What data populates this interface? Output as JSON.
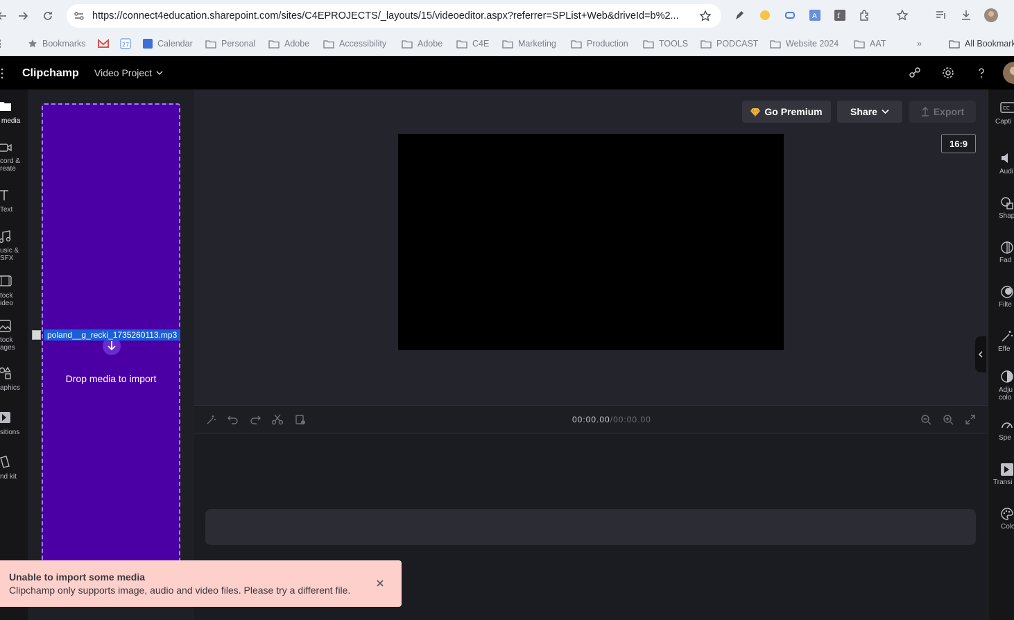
{
  "browser": {
    "url": "https://connect4education.sharepoint.com/sites/C4EPROJECTS/_layouts/15/videoeditor.aspx?referrer=SPList+Web&driveId=b%2...",
    "bookmarks": [
      {
        "label": "Bookmarks",
        "icon": "star-icon"
      },
      {
        "label": "",
        "icon": "gmail-icon"
      },
      {
        "label": "",
        "icon": "calendar-app-icon"
      },
      {
        "label": "Calendar",
        "icon": "calendar-icon"
      },
      {
        "label": "Personal",
        "icon": "folder-icon"
      },
      {
        "label": "Adobe",
        "icon": "folder-icon"
      },
      {
        "label": "Accessibility",
        "icon": "folder-icon"
      },
      {
        "label": "Adobe",
        "icon": "folder-icon"
      },
      {
        "label": "C4E",
        "icon": "folder-icon"
      },
      {
        "label": "Marketing",
        "icon": "folder-icon"
      },
      {
        "label": "Production",
        "icon": "folder-icon"
      },
      {
        "label": "TOOLS",
        "icon": "folder-icon"
      },
      {
        "label": "PODCAST",
        "icon": "folder-icon"
      },
      {
        "label": "Website 2024",
        "icon": "folder-icon"
      },
      {
        "label": "AAT",
        "icon": "folder-icon"
      }
    ],
    "more_bookmarks": "»",
    "all_bookmarks": "All Bookmarks"
  },
  "app": {
    "brand": "Clipchamp",
    "project_name": "Video Project"
  },
  "left_rail": [
    {
      "label": "media",
      "icon": "folder-icon"
    },
    {
      "label": "cord & reate",
      "icon": "camera-icon"
    },
    {
      "label": "Text",
      "icon": "text-icon"
    },
    {
      "label": "usic & SFX",
      "icon": "music-icon"
    },
    {
      "label": "tock ideo",
      "icon": "film-icon"
    },
    {
      "label": "tock ages",
      "icon": "image-icon"
    },
    {
      "label": "aphics",
      "icon": "shapes-icon"
    },
    {
      "label": "sitions",
      "icon": "transition-icon"
    },
    {
      "label": "nd kit",
      "icon": "brand-kit-icon"
    }
  ],
  "media_panel": {
    "drop_text": "Drop media to import",
    "dragged_file": "poland__g_recki_1735260113.mp3"
  },
  "stage": {
    "go_premium": "Go Premium",
    "share": "Share",
    "export": "Export",
    "aspect_ratio": "16:9"
  },
  "timeline": {
    "current_time": "00:00.00",
    "separator": "/",
    "total_time": "00:00.00"
  },
  "right_rail": [
    {
      "label": "Capti",
      "icon": "captions-icon"
    },
    {
      "label": "Audi",
      "icon": "speaker-icon"
    },
    {
      "label": "Shap",
      "icon": "shapes-icon"
    },
    {
      "label": "Fad",
      "icon": "fade-icon"
    },
    {
      "label": "Filte",
      "icon": "filter-icon"
    },
    {
      "label": "Effe",
      "icon": "wand-icon"
    },
    {
      "label": "Adju colo",
      "icon": "contrast-icon"
    },
    {
      "label": "Spe",
      "icon": "speed-icon"
    },
    {
      "label": "Transi",
      "icon": "transition-icon"
    },
    {
      "label": "Colo",
      "icon": "palette-icon"
    }
  ],
  "toast": {
    "title": "Unable to import some media",
    "message": "Clipchamp only supports image, audio and video files. Please try a different file."
  },
  "colors": {
    "drop_zone": "#4b00a6",
    "toast_bg": "#fdd0cc",
    "drag_highlight": "#1a5fd6"
  }
}
